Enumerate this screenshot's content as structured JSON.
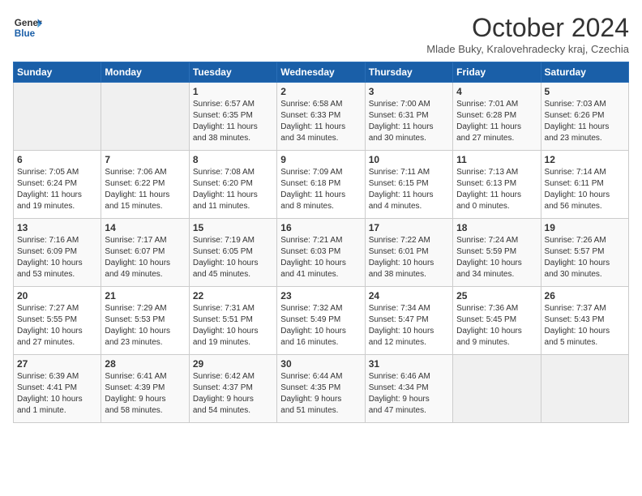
{
  "logo": {
    "line1": "General",
    "line2": "Blue"
  },
  "title": "October 2024",
  "location": "Mlade Buky, Kralovehradecky kraj, Czechia",
  "weekdays": [
    "Sunday",
    "Monday",
    "Tuesday",
    "Wednesday",
    "Thursday",
    "Friday",
    "Saturday"
  ],
  "weeks": [
    [
      {
        "day": "",
        "info": ""
      },
      {
        "day": "",
        "info": ""
      },
      {
        "day": "1",
        "info": "Sunrise: 6:57 AM\nSunset: 6:35 PM\nDaylight: 11 hours\nand 38 minutes."
      },
      {
        "day": "2",
        "info": "Sunrise: 6:58 AM\nSunset: 6:33 PM\nDaylight: 11 hours\nand 34 minutes."
      },
      {
        "day": "3",
        "info": "Sunrise: 7:00 AM\nSunset: 6:31 PM\nDaylight: 11 hours\nand 30 minutes."
      },
      {
        "day": "4",
        "info": "Sunrise: 7:01 AM\nSunset: 6:28 PM\nDaylight: 11 hours\nand 27 minutes."
      },
      {
        "day": "5",
        "info": "Sunrise: 7:03 AM\nSunset: 6:26 PM\nDaylight: 11 hours\nand 23 minutes."
      }
    ],
    [
      {
        "day": "6",
        "info": "Sunrise: 7:05 AM\nSunset: 6:24 PM\nDaylight: 11 hours\nand 19 minutes."
      },
      {
        "day": "7",
        "info": "Sunrise: 7:06 AM\nSunset: 6:22 PM\nDaylight: 11 hours\nand 15 minutes."
      },
      {
        "day": "8",
        "info": "Sunrise: 7:08 AM\nSunset: 6:20 PM\nDaylight: 11 hours\nand 11 minutes."
      },
      {
        "day": "9",
        "info": "Sunrise: 7:09 AM\nSunset: 6:18 PM\nDaylight: 11 hours\nand 8 minutes."
      },
      {
        "day": "10",
        "info": "Sunrise: 7:11 AM\nSunset: 6:15 PM\nDaylight: 11 hours\nand 4 minutes."
      },
      {
        "day": "11",
        "info": "Sunrise: 7:13 AM\nSunset: 6:13 PM\nDaylight: 11 hours\nand 0 minutes."
      },
      {
        "day": "12",
        "info": "Sunrise: 7:14 AM\nSunset: 6:11 PM\nDaylight: 10 hours\nand 56 minutes."
      }
    ],
    [
      {
        "day": "13",
        "info": "Sunrise: 7:16 AM\nSunset: 6:09 PM\nDaylight: 10 hours\nand 53 minutes."
      },
      {
        "day": "14",
        "info": "Sunrise: 7:17 AM\nSunset: 6:07 PM\nDaylight: 10 hours\nand 49 minutes."
      },
      {
        "day": "15",
        "info": "Sunrise: 7:19 AM\nSunset: 6:05 PM\nDaylight: 10 hours\nand 45 minutes."
      },
      {
        "day": "16",
        "info": "Sunrise: 7:21 AM\nSunset: 6:03 PM\nDaylight: 10 hours\nand 41 minutes."
      },
      {
        "day": "17",
        "info": "Sunrise: 7:22 AM\nSunset: 6:01 PM\nDaylight: 10 hours\nand 38 minutes."
      },
      {
        "day": "18",
        "info": "Sunrise: 7:24 AM\nSunset: 5:59 PM\nDaylight: 10 hours\nand 34 minutes."
      },
      {
        "day": "19",
        "info": "Sunrise: 7:26 AM\nSunset: 5:57 PM\nDaylight: 10 hours\nand 30 minutes."
      }
    ],
    [
      {
        "day": "20",
        "info": "Sunrise: 7:27 AM\nSunset: 5:55 PM\nDaylight: 10 hours\nand 27 minutes."
      },
      {
        "day": "21",
        "info": "Sunrise: 7:29 AM\nSunset: 5:53 PM\nDaylight: 10 hours\nand 23 minutes."
      },
      {
        "day": "22",
        "info": "Sunrise: 7:31 AM\nSunset: 5:51 PM\nDaylight: 10 hours\nand 19 minutes."
      },
      {
        "day": "23",
        "info": "Sunrise: 7:32 AM\nSunset: 5:49 PM\nDaylight: 10 hours\nand 16 minutes."
      },
      {
        "day": "24",
        "info": "Sunrise: 7:34 AM\nSunset: 5:47 PM\nDaylight: 10 hours\nand 12 minutes."
      },
      {
        "day": "25",
        "info": "Sunrise: 7:36 AM\nSunset: 5:45 PM\nDaylight: 10 hours\nand 9 minutes."
      },
      {
        "day": "26",
        "info": "Sunrise: 7:37 AM\nSunset: 5:43 PM\nDaylight: 10 hours\nand 5 minutes."
      }
    ],
    [
      {
        "day": "27",
        "info": "Sunrise: 6:39 AM\nSunset: 4:41 PM\nDaylight: 10 hours\nand 1 minute."
      },
      {
        "day": "28",
        "info": "Sunrise: 6:41 AM\nSunset: 4:39 PM\nDaylight: 9 hours\nand 58 minutes."
      },
      {
        "day": "29",
        "info": "Sunrise: 6:42 AM\nSunset: 4:37 PM\nDaylight: 9 hours\nand 54 minutes."
      },
      {
        "day": "30",
        "info": "Sunrise: 6:44 AM\nSunset: 4:35 PM\nDaylight: 9 hours\nand 51 minutes."
      },
      {
        "day": "31",
        "info": "Sunrise: 6:46 AM\nSunset: 4:34 PM\nDaylight: 9 hours\nand 47 minutes."
      },
      {
        "day": "",
        "info": ""
      },
      {
        "day": "",
        "info": ""
      }
    ]
  ]
}
